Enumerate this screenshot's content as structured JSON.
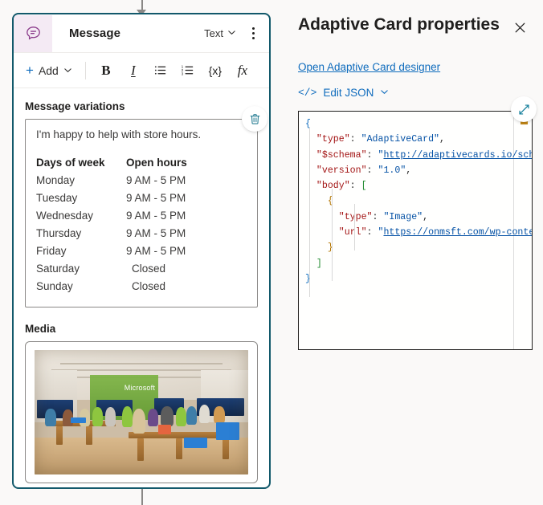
{
  "flow_node": {
    "icon": "message-bubble-icon",
    "title": "Message",
    "type_selector": {
      "label": "Text",
      "chevron": "chevron-down-icon"
    },
    "overflow_menu": "more-options-icon",
    "toolbar": {
      "add_label": "Add",
      "add_plus": "plus-icon",
      "add_chevron": "chevron-down-icon",
      "bold": "B",
      "italic": "I",
      "bulleted_list": "bulleted-list-icon",
      "numbered_list": "numbered-list-icon",
      "variable": "{x}",
      "formula": "fx"
    },
    "sections": {
      "variations_label": "Message variations",
      "media_label": "Media"
    },
    "delete_button": "delete-icon",
    "variation": {
      "intro": "I'm happy to help with store hours.",
      "table": {
        "headers": [
          "Days of week",
          "Open hours"
        ],
        "rows": [
          [
            "Monday",
            "9 AM - 5 PM"
          ],
          [
            "Tuesday",
            "9 AM - 5 PM"
          ],
          [
            "Wednesday",
            "9 AM - 5 PM"
          ],
          [
            "Thursday",
            "9 AM - 5 PM"
          ],
          [
            "Friday",
            "9 AM - 5 PM"
          ],
          [
            "Saturday",
            "Closed"
          ],
          [
            "Sunday",
            "Closed"
          ]
        ]
      }
    },
    "media": {
      "alt": "Microsoft Store interior with customers at tables",
      "store_sign": "Microsoft"
    }
  },
  "panel": {
    "title": "Adaptive Card properties",
    "close_icon": "close-icon",
    "designer_link": "Open Adaptive Card designer",
    "edit_json": {
      "icon": "code-icon",
      "label": "Edit JSON",
      "chevron": "chevron-down-icon"
    },
    "expand_button": "expand-icon",
    "json": {
      "lines": [
        "{",
        "  \"type\": \"AdaptiveCard\",",
        "  \"$schema\": \"http://adaptivecards.io/schemas/adaptive-card.json\",",
        "  \"version\": \"1.0\",",
        "  \"body\": [",
        "    {",
        "      \"type\": \"Image\",",
        "      \"url\": \"https://onmsft.com/wp-content/uploads/store.jpg\"",
        "    }",
        "  ]",
        "}"
      ],
      "keys": [
        "type",
        "$schema",
        "version",
        "body",
        "type",
        "url"
      ],
      "values": {
        "type": "AdaptiveCard",
        "schema": "http://adaptivecards.io/schemas/adaptive-card.json",
        "version": "1.0",
        "body_item_type": "Image",
        "body_item_url": "https://onmsft.com/wp-content/uploads/store.jpg"
      }
    }
  },
  "colors": {
    "node_border": "#12596b",
    "node_icon_bg": "#f4eaf4",
    "node_icon_fg": "#8b3c8b",
    "accent_link": "#0f6cbd",
    "delete_icon": "#2a7f95",
    "json_key": "#a31515",
    "json_string": "#0451a5",
    "marker": "#c58917"
  }
}
